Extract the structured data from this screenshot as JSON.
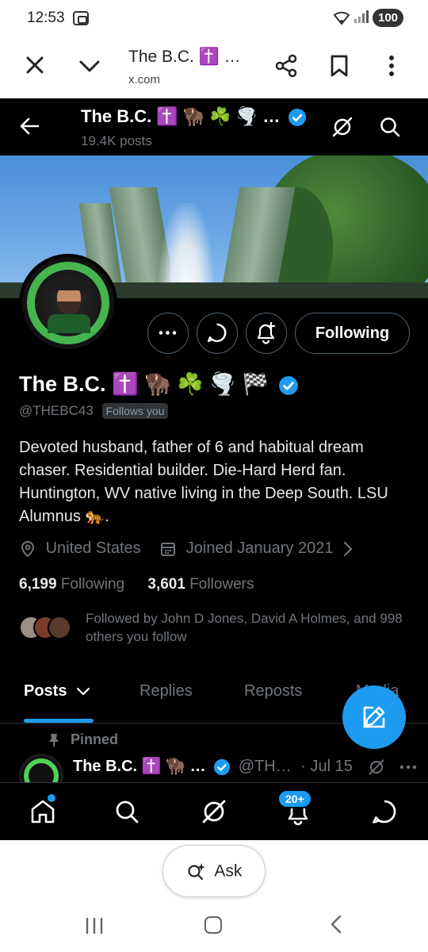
{
  "status_bar": {
    "time": "12:53",
    "battery": "100"
  },
  "browser": {
    "page_title": "The B.C. ✝️ …",
    "url": "x.com",
    "icons": [
      "close-icon",
      "chevron-down-icon",
      "share-icon",
      "bookmark-icon",
      "more-vertical-icon"
    ]
  },
  "x_header": {
    "name": "The B.C. ✝️ 🦬 ☘️ 🌪️ …",
    "post_count": "19.4K posts"
  },
  "profile": {
    "display_name": "The B.C. ✝️ 🦬 ☘️ 🌪️ 🏁",
    "handle": "@THEBC43",
    "follows_you": "Follows you",
    "bio": "Devoted husband, father of 6 and habitual dream chaser. Residential builder. Die-Hard Herd fan. Huntington, WV native living in the Deep South. LSU Alumnus 🐅.",
    "location": "United States",
    "joined": "Joined January 2021",
    "following_count": "6,199",
    "following_label": "Following",
    "followers_count": "3,601",
    "followers_label": "Followers",
    "followed_by": "Followed by John D Jones, David A Holmes, and 998 others you follow",
    "following_button": "Following"
  },
  "tabs": [
    {
      "label": "Posts",
      "active": true
    },
    {
      "label": "Replies",
      "active": false
    },
    {
      "label": "Reposts",
      "active": false
    },
    {
      "label": "Media",
      "active": false
    }
  ],
  "pinned_post": {
    "pinned_label": "Pinned",
    "author": "The B.C. ✝️ 🦬 …",
    "handle": "@TH…",
    "date": "· Jul 15"
  },
  "bottom_nav": {
    "notification_badge": "20+"
  },
  "ask": {
    "label": "Ask"
  },
  "colors": {
    "x_blue": "#1d9bf0",
    "background": "#000000",
    "muted_text": "#71767b"
  }
}
